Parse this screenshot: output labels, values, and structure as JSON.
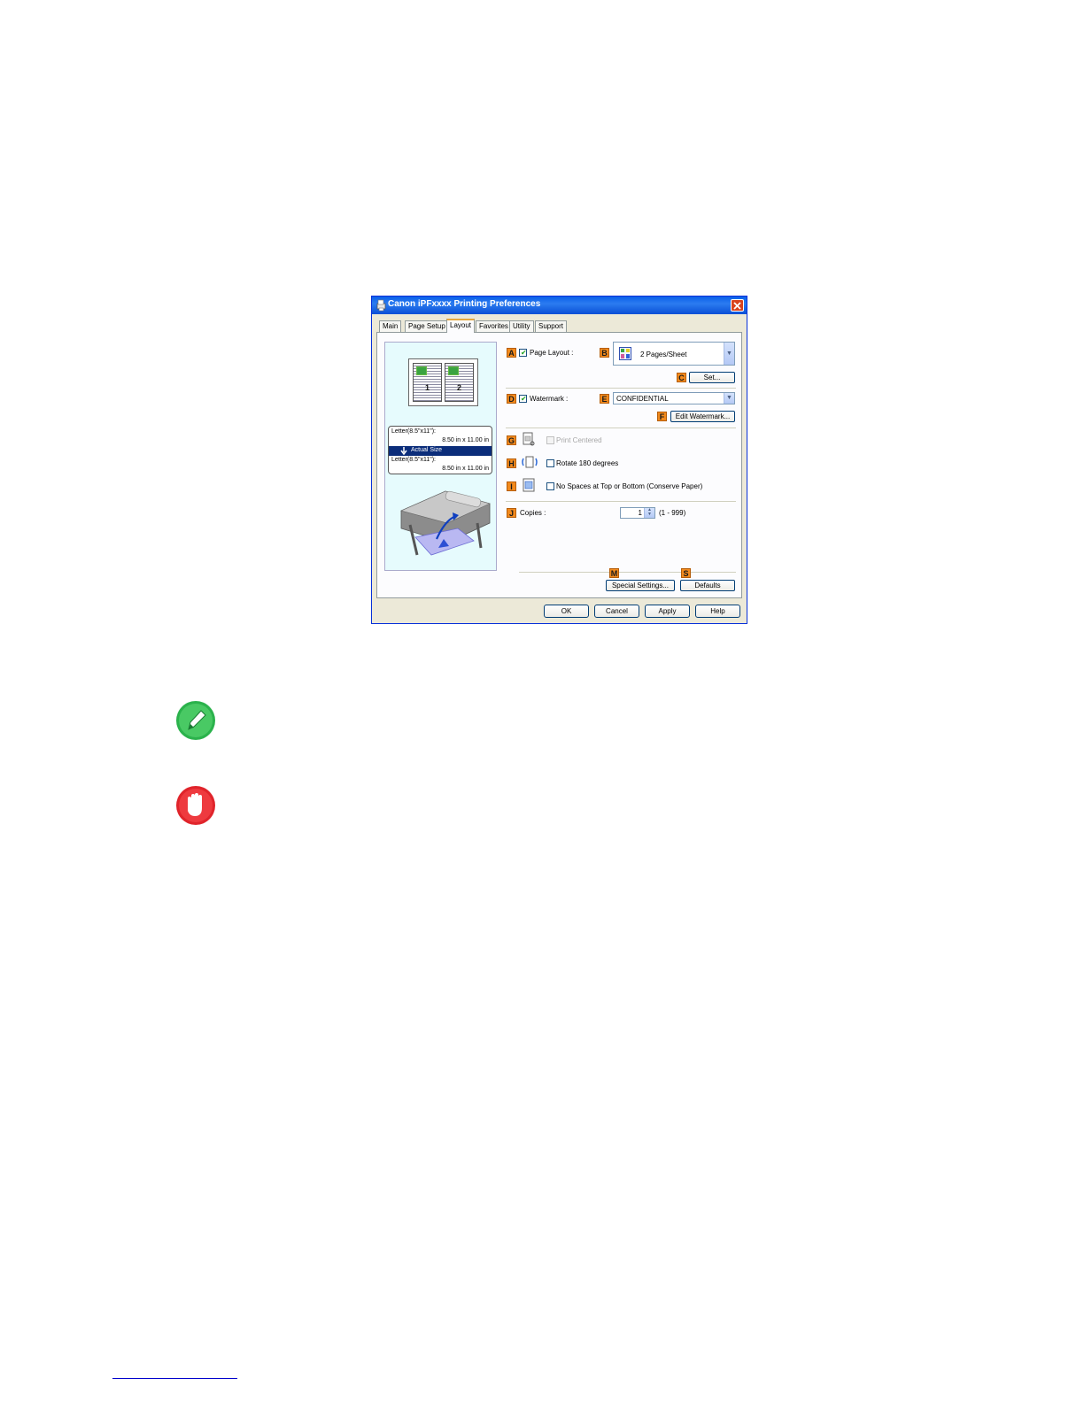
{
  "dialog": {
    "title": "Canon iPFxxxx Printing Preferences",
    "tabs": [
      {
        "label": "Main"
      },
      {
        "label": "Page Setup"
      },
      {
        "label": "Layout",
        "active": true
      },
      {
        "label": "Favorites"
      },
      {
        "label": "Utility"
      },
      {
        "label": "Support"
      }
    ],
    "preview": {
      "page_numbers": [
        "1",
        "2"
      ],
      "original_size_name": "Letter(8.5\"x11\"):",
      "original_size_dims": "8.50 in x 11.00 in",
      "active_label": "Actual Size",
      "output_size_name": "Letter(8.5\"x11\"):",
      "output_size_dims": "8.50 in x 11.00 in"
    },
    "options": {
      "page_layout": {
        "tag": "A",
        "label": "Page Layout :",
        "checked": true
      },
      "pages_per_sheet": {
        "tag": "B",
        "value": "2 Pages/Sheet"
      },
      "set_button": {
        "tag": "C",
        "label": "Set..."
      },
      "watermark": {
        "tag": "D",
        "label": "Watermark :",
        "checked": true
      },
      "watermark_select": {
        "tag": "E",
        "value": "CONFIDENTIAL"
      },
      "edit_watermark_button": {
        "tag": "F",
        "label": "Edit Watermark..."
      },
      "print_centered": {
        "tag": "G",
        "label": "Print Centered",
        "checked": false,
        "enabled": false
      },
      "rotate_180": {
        "tag": "H",
        "label": "Rotate 180 degrees",
        "checked": false
      },
      "no_spaces": {
        "tag": "I",
        "label": "No Spaces at Top or Bottom (Conserve Paper)",
        "checked": false
      },
      "copies": {
        "tag": "J",
        "label": "Copies :",
        "value": "1",
        "range": "(1 - 999)"
      },
      "special_settings_button": {
        "tag": "M",
        "label": "Special Settings..."
      },
      "defaults_button": {
        "tag": "S",
        "label": "Defaults"
      }
    },
    "buttons": {
      "ok": "OK",
      "cancel": "Cancel",
      "apply": "Apply",
      "help": "Help"
    }
  },
  "icons": {
    "note": "pencil-icon",
    "important": "hand-stop-icon"
  },
  "colors": {
    "tag_orange": "#f28a1d",
    "title_blue": "#0a5fe8",
    "note_green": "#2bb24c",
    "important_red": "#e0242b"
  }
}
